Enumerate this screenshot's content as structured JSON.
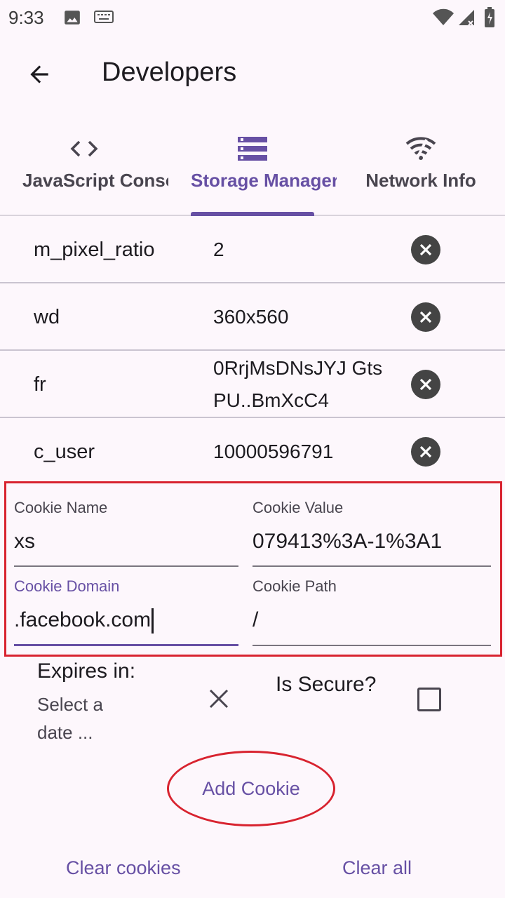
{
  "status_bar": {
    "time": "9:33",
    "icons": [
      "image-icon",
      "keyboard-icon",
      "wifi-icon",
      "signal-icon",
      "battery-icon"
    ]
  },
  "app_bar": {
    "title": "Developers",
    "back_icon": "arrow-back-icon"
  },
  "tabs": [
    {
      "label": "JavaScript Console",
      "icon": "code-icon",
      "active": false
    },
    {
      "label": "Storage Manager",
      "icon": "storage-icon",
      "active": true
    },
    {
      "label": "Network Info",
      "icon": "wifi-icon",
      "active": false
    }
  ],
  "cookies": [
    {
      "name": "m_pixel_ratio",
      "value": "2"
    },
    {
      "name": "wd",
      "value": "360x560"
    },
    {
      "name": "fr",
      "value": "0RrjMsDNsJYJ GtsPU..BmXcC4"
    },
    {
      "name": "c_user",
      "value": "10000596791"
    }
  ],
  "form": {
    "cookie_name": {
      "label": "Cookie Name",
      "value": "xs"
    },
    "cookie_value": {
      "label": "Cookie Value",
      "value": "079413%3A-1%3A1"
    },
    "cookie_domain": {
      "label": "Cookie Domain",
      "value": ".facebook.com"
    },
    "cookie_path": {
      "label": "Cookie Path",
      "value": "/"
    }
  },
  "expires": {
    "label": "Expires in:",
    "placeholder": "Select a date ..."
  },
  "secure": {
    "label": "Is Secure?",
    "checked": false
  },
  "buttons": {
    "add_cookie": "Add Cookie",
    "clear_cookies": "Clear cookies",
    "clear_all": "Clear all"
  },
  "colors": {
    "accent": "#6750a4",
    "highlight": "#d8232f",
    "background": "#fdf7fc"
  }
}
